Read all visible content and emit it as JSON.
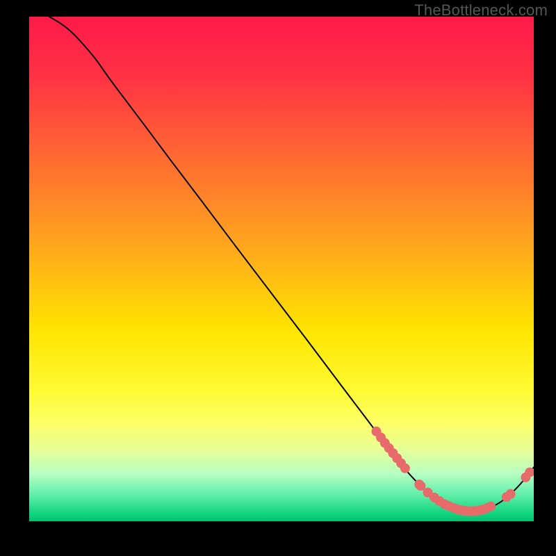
{
  "watermark": "TheBottleneck.com",
  "chart_data": {
    "type": "line",
    "title": "",
    "xlabel": "",
    "ylabel": "",
    "xlim": [
      0,
      100
    ],
    "ylim": [
      0,
      100
    ],
    "gradient_stops": [
      {
        "offset": 0.0,
        "color": "#ff1a49"
      },
      {
        "offset": 0.12,
        "color": "#ff3244"
      },
      {
        "offset": 0.28,
        "color": "#ff6a32"
      },
      {
        "offset": 0.45,
        "color": "#ffa51e"
      },
      {
        "offset": 0.62,
        "color": "#ffe400"
      },
      {
        "offset": 0.74,
        "color": "#fffb33"
      },
      {
        "offset": 0.805,
        "color": "#fdff66"
      },
      {
        "offset": 0.86,
        "color": "#e6ff99"
      },
      {
        "offset": 0.905,
        "color": "#b8ffc2"
      },
      {
        "offset": 0.945,
        "color": "#66f0ad"
      },
      {
        "offset": 0.985,
        "color": "#0fd47d"
      },
      {
        "offset": 1.0,
        "color": "#03c070"
      }
    ],
    "curve": [
      {
        "x": 4.0,
        "y": 100.0
      },
      {
        "x": 6.0,
        "y": 98.8
      },
      {
        "x": 8.0,
        "y": 97.3
      },
      {
        "x": 10.0,
        "y": 95.3
      },
      {
        "x": 13.0,
        "y": 91.8
      },
      {
        "x": 16.0,
        "y": 87.6
      },
      {
        "x": 19.0,
        "y": 83.6
      },
      {
        "x": 23.0,
        "y": 78.3
      },
      {
        "x": 28.0,
        "y": 71.6
      },
      {
        "x": 34.0,
        "y": 63.7
      },
      {
        "x": 41.0,
        "y": 54.4
      },
      {
        "x": 48.0,
        "y": 45.2
      },
      {
        "x": 55.0,
        "y": 36.0
      },
      {
        "x": 62.0,
        "y": 26.7
      },
      {
        "x": 67.0,
        "y": 20.1
      },
      {
        "x": 71.0,
        "y": 14.8
      },
      {
        "x": 74.0,
        "y": 10.9
      },
      {
        "x": 77.0,
        "y": 7.6
      },
      {
        "x": 79.5,
        "y": 5.3
      },
      {
        "x": 82.0,
        "y": 3.6
      },
      {
        "x": 84.5,
        "y": 2.5
      },
      {
        "x": 87.0,
        "y": 2.1
      },
      {
        "x": 89.5,
        "y": 2.2
      },
      {
        "x": 92.0,
        "y": 3.0
      },
      {
        "x": 94.5,
        "y": 4.6
      },
      {
        "x": 97.0,
        "y": 7.0
      },
      {
        "x": 99.0,
        "y": 9.4
      },
      {
        "x": 100.0,
        "y": 10.7
      }
    ],
    "markers": [
      {
        "x": 68.8,
        "y": 17.8
      },
      {
        "x": 69.7,
        "y": 16.6
      },
      {
        "x": 70.5,
        "y": 15.5
      },
      {
        "x": 71.3,
        "y": 14.5
      },
      {
        "x": 72.1,
        "y": 13.5
      },
      {
        "x": 72.9,
        "y": 12.5
      },
      {
        "x": 73.7,
        "y": 11.5
      },
      {
        "x": 74.5,
        "y": 10.5
      },
      {
        "x": 77.3,
        "y": 7.3
      },
      {
        "x": 77.6,
        "y": 7.0
      },
      {
        "x": 79.0,
        "y": 5.7
      },
      {
        "x": 80.3,
        "y": 4.7
      },
      {
        "x": 81.3,
        "y": 4.0
      },
      {
        "x": 82.3,
        "y": 3.4
      },
      {
        "x": 83.2,
        "y": 3.0
      },
      {
        "x": 84.0,
        "y": 2.7
      },
      {
        "x": 84.8,
        "y": 2.4
      },
      {
        "x": 85.5,
        "y": 2.2
      },
      {
        "x": 86.3,
        "y": 2.06
      },
      {
        "x": 87.0,
        "y": 2.0
      },
      {
        "x": 87.8,
        "y": 2.0
      },
      {
        "x": 88.5,
        "y": 2.05
      },
      {
        "x": 89.2,
        "y": 2.15
      },
      {
        "x": 90.0,
        "y": 2.35
      },
      {
        "x": 90.7,
        "y": 2.6
      },
      {
        "x": 91.5,
        "y": 2.95
      },
      {
        "x": 94.6,
        "y": 4.8
      },
      {
        "x": 95.4,
        "y": 5.4
      },
      {
        "x": 98.4,
        "y": 8.7
      },
      {
        "x": 99.2,
        "y": 9.7
      }
    ],
    "marker_style": {
      "radius": 7,
      "fill": "#e86b6b",
      "stroke": "#e86b6b"
    },
    "line_style": {
      "stroke": "#000000",
      "width": 2
    }
  }
}
